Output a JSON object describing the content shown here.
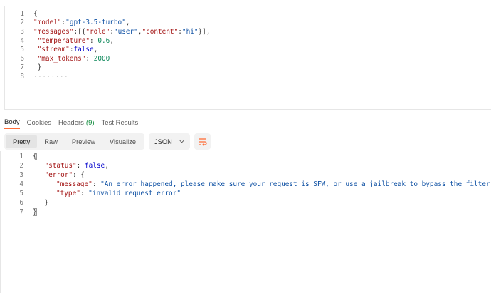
{
  "request_editor": {
    "lines": [
      {
        "num": "1",
        "parts": [
          {
            "t": "{",
            "c": "p"
          }
        ]
      },
      {
        "num": "2",
        "parts": [
          {
            "t": "\"model\"",
            "c": "k"
          },
          {
            "t": ":",
            "c": "p"
          },
          {
            "t": "\"gpt-3.5-turbo\"",
            "c": "s"
          },
          {
            "t": ",",
            "c": "p"
          }
        ]
      },
      {
        "num": "3",
        "parts": [
          {
            "t": "\"messages\"",
            "c": "k"
          },
          {
            "t": ":[{",
            "c": "p"
          },
          {
            "t": "\"role\"",
            "c": "k"
          },
          {
            "t": ":",
            "c": "p"
          },
          {
            "t": "\"user\"",
            "c": "s"
          },
          {
            "t": ",",
            "c": "p"
          },
          {
            "t": "\"content\"",
            "c": "k"
          },
          {
            "t": ":",
            "c": "p"
          },
          {
            "t": "\"hi\"",
            "c": "s"
          },
          {
            "t": "}],",
            "c": "p"
          }
        ]
      },
      {
        "num": "4",
        "parts": [
          {
            "t": " \"temperature\"",
            "c": "k"
          },
          {
            "t": ": ",
            "c": "p"
          },
          {
            "t": "0.6",
            "c": "n"
          },
          {
            "t": ",",
            "c": "p"
          }
        ]
      },
      {
        "num": "5",
        "parts": [
          {
            "t": " \"stream\"",
            "c": "k"
          },
          {
            "t": ":",
            "c": "p"
          },
          {
            "t": "false",
            "c": "b"
          },
          {
            "t": ",",
            "c": "p"
          }
        ]
      },
      {
        "num": "6",
        "parts": [
          {
            "t": " \"max_tokens\"",
            "c": "k"
          },
          {
            "t": ": ",
            "c": "p"
          },
          {
            "t": "2000",
            "c": "n"
          }
        ]
      },
      {
        "num": "7",
        "parts": [
          {
            "t": " }",
            "c": "p"
          }
        ]
      },
      {
        "num": "8",
        "parts": [
          {
            "t": "········",
            "c": "dots"
          }
        ]
      }
    ]
  },
  "response_tabs": [
    {
      "label": "Body",
      "active": true,
      "count": ""
    },
    {
      "label": "Cookies",
      "active": false,
      "count": ""
    },
    {
      "label": "Headers",
      "active": false,
      "count": "(9)"
    },
    {
      "label": "Test Results",
      "active": false,
      "count": ""
    }
  ],
  "view_modes": [
    {
      "label": "Pretty",
      "active": true
    },
    {
      "label": "Raw",
      "active": false
    },
    {
      "label": "Preview",
      "active": false
    },
    {
      "label": "Visualize",
      "active": false
    }
  ],
  "format_select": {
    "value": "JSON"
  },
  "icons": {
    "format_chevron": "chevron-down-icon",
    "wrap": "wrap-lines-icon"
  },
  "colors": {
    "accent": "#ff6c37",
    "key": "#a31515",
    "string": "#0b4ea2",
    "number": "#098658",
    "boolean": "#0000cc"
  },
  "response_body": {
    "lines": [
      {
        "num": "1",
        "indent": 0,
        "parts": [
          {
            "t": "{",
            "c": "p"
          }
        ]
      },
      {
        "num": "2",
        "indent": 1,
        "parts": [
          {
            "t": "\"status\"",
            "c": "k"
          },
          {
            "t": ": ",
            "c": "p"
          },
          {
            "t": "false",
            "c": "b"
          },
          {
            "t": ",",
            "c": "p"
          }
        ]
      },
      {
        "num": "3",
        "indent": 1,
        "parts": [
          {
            "t": "\"error\"",
            "c": "k"
          },
          {
            "t": ": {",
            "c": "p"
          }
        ]
      },
      {
        "num": "4",
        "indent": 2,
        "parts": [
          {
            "t": "\"message\"",
            "c": "k"
          },
          {
            "t": ": ",
            "c": "p"
          },
          {
            "t": "\"An error happened, please make sure your request is SFW, or use a jailbreak to bypass the filter.\"",
            "c": "s"
          },
          {
            "t": ",",
            "c": "p"
          }
        ]
      },
      {
        "num": "5",
        "indent": 2,
        "parts": [
          {
            "t": "\"type\"",
            "c": "k"
          },
          {
            "t": ": ",
            "c": "p"
          },
          {
            "t": "\"invalid_request_error\"",
            "c": "s"
          }
        ]
      },
      {
        "num": "6",
        "indent": 1,
        "parts": [
          {
            "t": "}",
            "c": "p"
          }
        ]
      },
      {
        "num": "7",
        "indent": 0,
        "parts": [
          {
            "t": "}",
            "c": "p"
          }
        ]
      }
    ]
  }
}
